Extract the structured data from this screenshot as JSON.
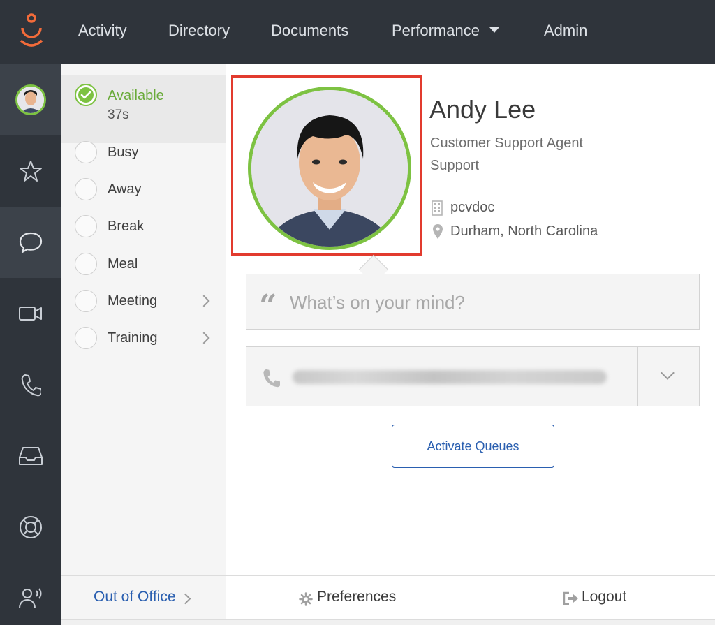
{
  "nav": {
    "items": [
      {
        "label": "Activity"
      },
      {
        "label": "Directory"
      },
      {
        "label": "Documents"
      },
      {
        "label": "Performance"
      },
      {
        "label": "Admin"
      }
    ]
  },
  "rail": {
    "icons": [
      "avatar",
      "star-icon",
      "chat-icon",
      "video-icon",
      "phone-icon",
      "inbox-icon",
      "lifebuoy-icon",
      "broadcast-user-icon"
    ]
  },
  "status": {
    "current": {
      "label": "Available",
      "duration": "37s"
    },
    "options": [
      {
        "label": "Busy"
      },
      {
        "label": "Away"
      },
      {
        "label": "Break"
      },
      {
        "label": "Meal"
      },
      {
        "label": "Meeting"
      },
      {
        "label": "Training"
      }
    ]
  },
  "profile": {
    "name": "Andy Lee",
    "title": "Customer Support Agent",
    "department": "Support",
    "organization": "pcvdoc",
    "location": "Durham, North Carolina"
  },
  "mind": {
    "placeholder": "What’s on your mind?"
  },
  "actions": {
    "activate_queues": "Activate Queues"
  },
  "bottom": {
    "out_of_office": "Out of Office",
    "preferences": "Preferences",
    "logout": "Logout"
  },
  "colors": {
    "nav_bg": "#2f343b",
    "accent_green": "#7dc242",
    "link_blue": "#2a5fb0",
    "highlight_red": "#e23b2e",
    "logo_orange": "#f26b3a"
  }
}
